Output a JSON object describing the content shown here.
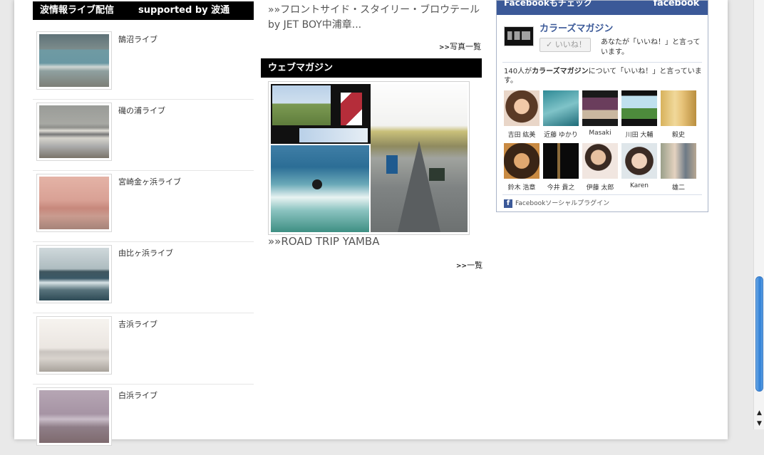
{
  "surf": {
    "header_left": "波情報ライブ配信",
    "header_right": "supported by 波通",
    "items": [
      {
        "label": "鵠沼ライブ"
      },
      {
        "label": "磯の浦ライブ"
      },
      {
        "label": "宮崎金ヶ浜ライブ"
      },
      {
        "label": "由比ヶ浜ライブ"
      },
      {
        "label": "吉浜ライブ"
      },
      {
        "label": "白浜ライブ"
      }
    ]
  },
  "news": {
    "title": "»»フロントサイド・スタイリー・ブロウテール by JET BOY中浦章...",
    "more_label": "写真一覧",
    "more_prefix": ">>"
  },
  "magazine": {
    "header": "ウェブマガジン",
    "caption": "»»ROAD TRIP YAMBA",
    "more_label": "一覧",
    "more_prefix": ">>"
  },
  "facebook": {
    "bar_title": "Facebookもチェック",
    "logo": "facebook",
    "page_name": "カラーズマガジン",
    "like_button": "いいね！",
    "like_text": "あなたが「いいね！」と言っています。",
    "count_prefix": "140人が",
    "count_page": "カラーズマガジン",
    "count_suffix": "について「いいね！」と言っています。",
    "faces": [
      {
        "name": "吉田 紘美"
      },
      {
        "name": "近藤 ゆかり"
      },
      {
        "name": "Masaki"
      },
      {
        "name": "川田 大輔"
      },
      {
        "name": "毅史"
      },
      {
        "name": "鈴木 浩章"
      },
      {
        "name": "今井 貴之"
      },
      {
        "name": "伊藤 太郎"
      },
      {
        "name": "Karen"
      },
      {
        "name": "雄二"
      }
    ],
    "plugin_label": "Facebookソーシャルプラグイン",
    "accent": "#3b5998"
  },
  "scroll": {
    "up": "▲",
    "down": "▼"
  }
}
